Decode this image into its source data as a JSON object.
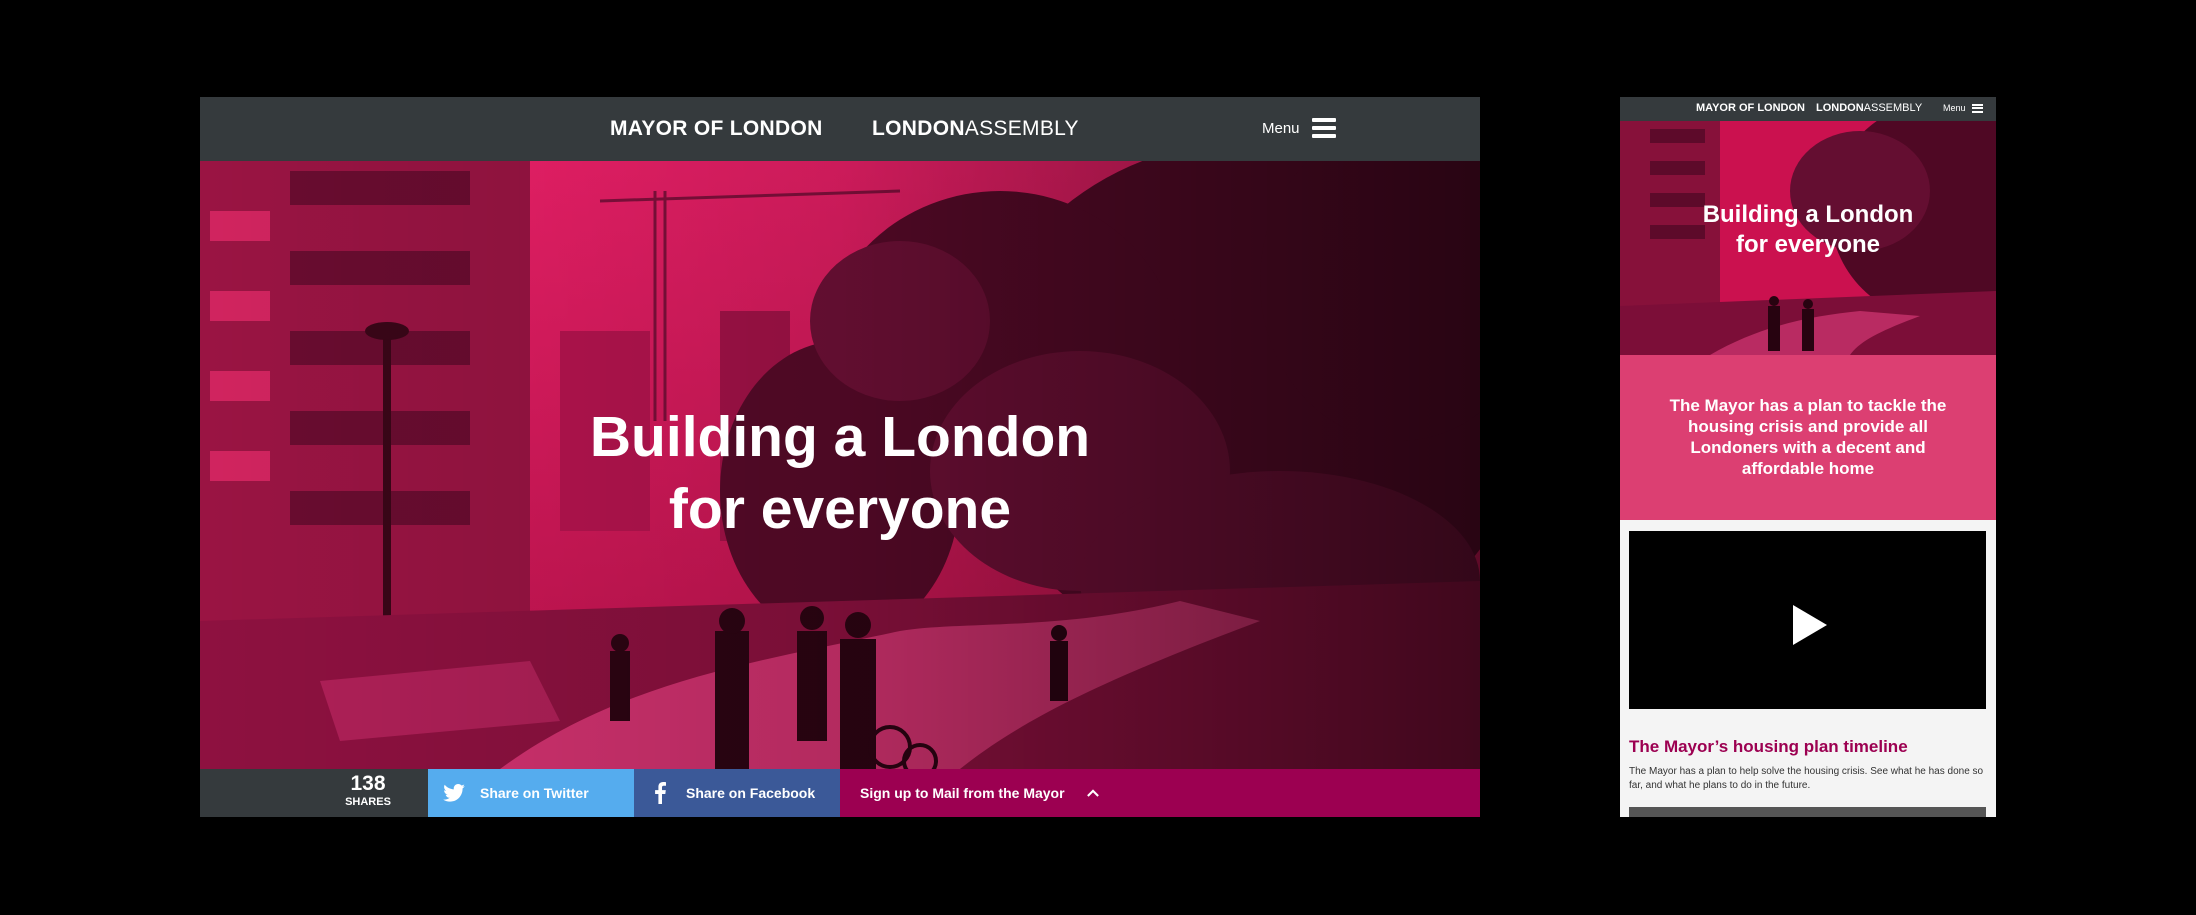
{
  "desktop": {
    "header": {
      "logo_mayor": "MAYOR OF LONDON",
      "logo_assembly_bold": "LONDON",
      "logo_assembly_light": "ASSEMBLY",
      "menu_label": "Menu"
    },
    "hero": {
      "title_line1": "Building a London",
      "title_line2": "for everyone"
    },
    "share_bar": {
      "count": "138",
      "count_label": "SHARES",
      "twitter_label": "Share on Twitter",
      "facebook_label": "Share on Facebook",
      "mail_label": "Sign up to Mail from the Mayor"
    }
  },
  "mobile": {
    "header": {
      "logo_mayor": "MAYOR OF LONDON",
      "logo_assembly_bold": "LONDON",
      "logo_assembly_light": "ASSEMBLY",
      "menu_label": "Menu"
    },
    "hero": {
      "title_line1": "Building a London",
      "title_line2": "for everyone"
    },
    "intro": "The Mayor has a plan to tackle the housing crisis and provide all Londoners with a decent and affordable home",
    "timeline_heading": "The Mayor’s housing plan timeline",
    "timeline_description": "The Mayor has a plan to help solve the housing crisis. See what he has done so far, and what he plans to do in the future."
  },
  "colors": {
    "header_bg": "#353a3d",
    "hero_tint": "#e8145a",
    "twitter": "#55acee",
    "facebook": "#3b5998",
    "mail": "#9c0051",
    "intro_bg": "#dc3f72",
    "heading": "#9c0051"
  },
  "icons": [
    "hamburger-menu-icon",
    "twitter-bird-icon",
    "facebook-f-icon",
    "chevron-up-icon",
    "play-icon"
  ]
}
